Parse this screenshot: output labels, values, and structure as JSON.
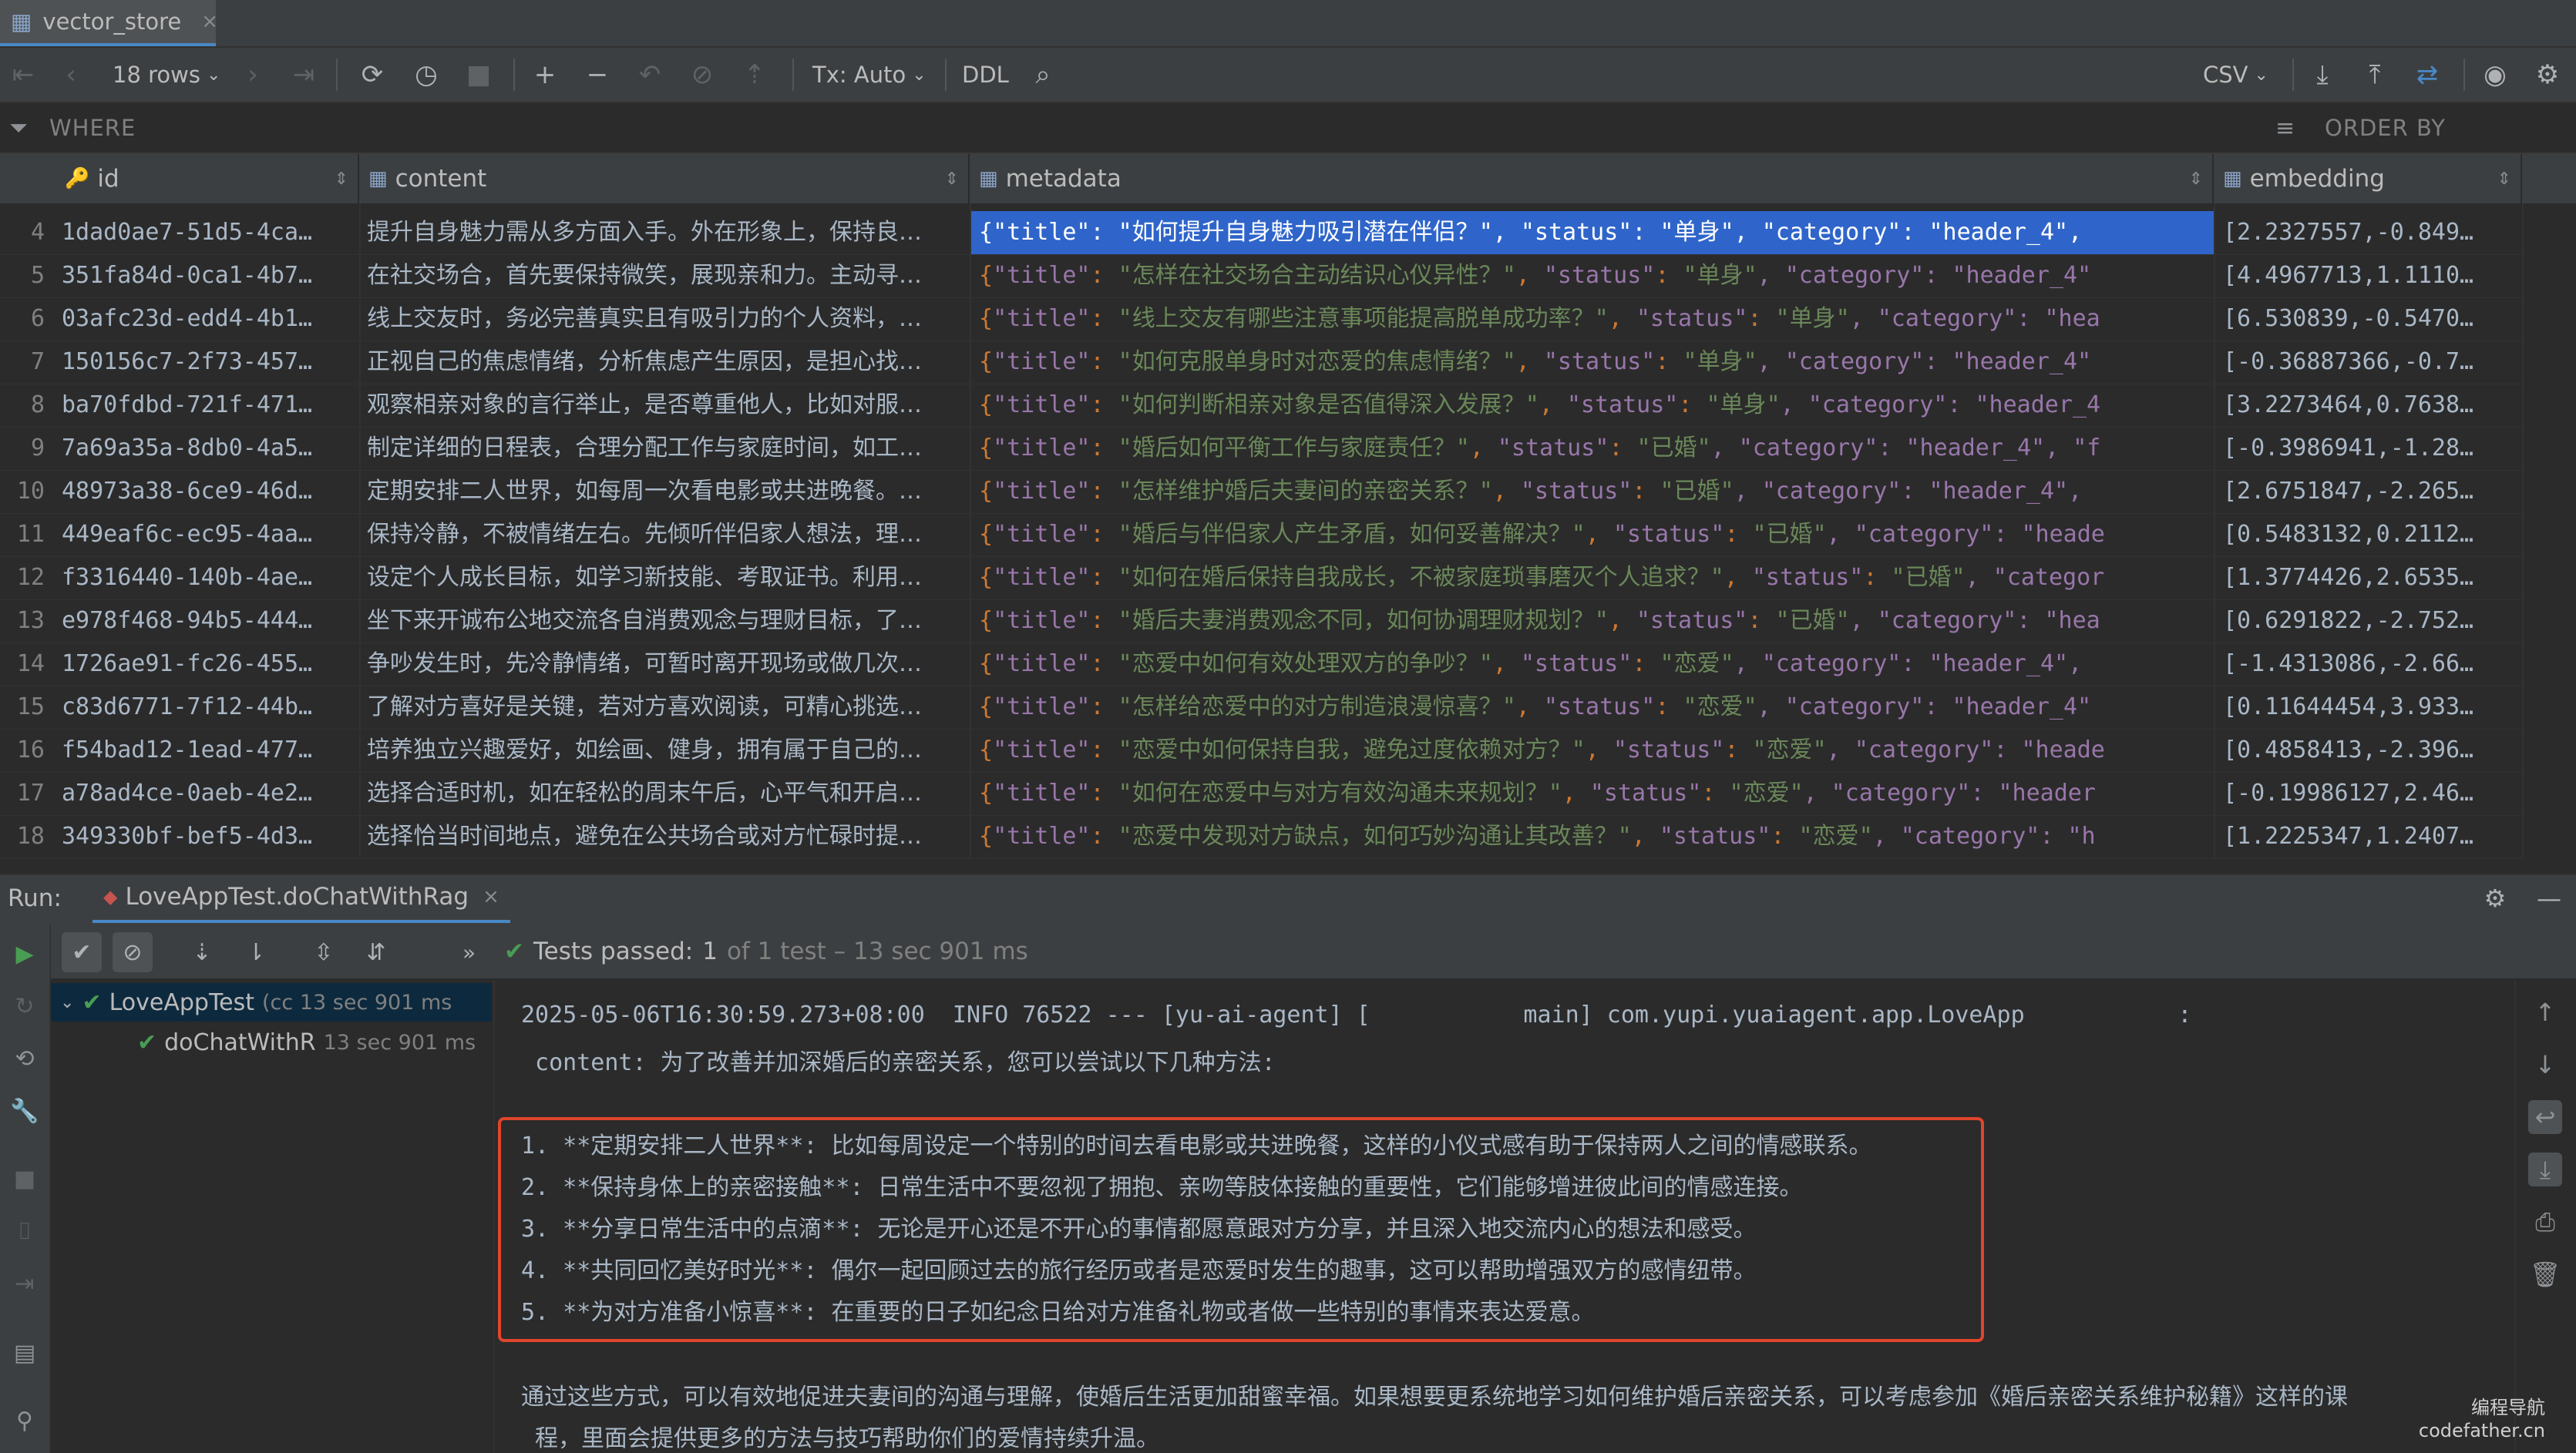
{
  "tab": {
    "title": "vector_store",
    "close": "×"
  },
  "toolbar": {
    "rows": "18 rows",
    "tx": "Tx: Auto",
    "ddl": "DDL",
    "export_format": "CSV"
  },
  "filter": {
    "where": "WHERE",
    "order_by": "ORDER BY"
  },
  "columns": [
    "id",
    "content",
    "metadata",
    "embedding"
  ],
  "rows": [
    {
      "n": "4",
      "id": "1dad0ae7-51d5-4ca…",
      "content": "提升自身魅力需从多方面入手。外在形象上，保持良…",
      "title": "如何提升自身魅力吸引潜在伴侣？",
      "status": "单身",
      "tail": ", \"category\": \"header_4\",",
      "embedding": "[2.2327557,-0.849…"
    },
    {
      "n": "5",
      "id": "351fa84d-0ca1-4b7…",
      "content": "在社交场合，首先要保持微笑，展现亲和力。主动寻…",
      "title": "怎样在社交场合主动结识心仪异性？",
      "status": "单身",
      "tail": ", \"category\": \"header_4\"",
      "embedding": "[4.4967713,1.1110…"
    },
    {
      "n": "6",
      "id": "03afc23d-edd4-4b1…",
      "content": "线上交友时，务必完善真实且有吸引力的个人资料，…",
      "title": "线上交友有哪些注意事项能提高脱单成功率？",
      "status": "单身",
      "tail": ", \"category\": \"hea",
      "embedding": "[6.530839,-0.5470…"
    },
    {
      "n": "7",
      "id": "150156c7-2f73-457…",
      "content": "正视自己的焦虑情绪，分析焦虑产生原因，是担心找…",
      "title": "如何克服单身时对恋爱的焦虑情绪？",
      "status": "单身",
      "tail": ", \"category\": \"header_4\"",
      "embedding": "[-0.36887366,-0.7…"
    },
    {
      "n": "8",
      "id": "ba70fdbd-721f-471…",
      "content": "观察相亲对象的言行举止，是否尊重他人，比如对服…",
      "title": "如何判断相亲对象是否值得深入发展？",
      "status": "单身",
      "tail": ", \"category\": \"header_4",
      "embedding": "[3.2273464,0.7638…"
    },
    {
      "n": "9",
      "id": "7a69a35a-8db0-4a5…",
      "content": "制定详细的日程表，合理分配工作与家庭时间，如工…",
      "title": "婚后如何平衡工作与家庭责任？",
      "status": "已婚",
      "tail": ", \"category\": \"header_4\", \"f",
      "embedding": "[-0.3986941,-1.28…"
    },
    {
      "n": "10",
      "id": "48973a38-6ce9-46d…",
      "content": "定期安排二人世界，如每周一次看电影或共进晚餐。…",
      "title": "怎样维护婚后夫妻间的亲密关系？",
      "status": "已婚",
      "tail": ", \"category\": \"header_4\",",
      "embedding": "[2.6751847,-2.265…"
    },
    {
      "n": "11",
      "id": "449eaf6c-ec95-4aa…",
      "content": "保持冷静，不被情绪左右。先倾听伴侣家人想法，理…",
      "title": "婚后与伴侣家人产生矛盾，如何妥善解决？",
      "status": "已婚",
      "tail": ", \"category\": \"heade",
      "embedding": "[0.5483132,0.2112…"
    },
    {
      "n": "12",
      "id": "f3316440-140b-4ae…",
      "content": "设定个人成长目标，如学习新技能、考取证书。利用…",
      "title": "如何在婚后保持自我成长，不被家庭琐事磨灭个人追求？",
      "status": "已婚",
      "tail": ", \"categor",
      "embedding": "[1.3774426,2.6535…"
    },
    {
      "n": "13",
      "id": "e978f468-94b5-444…",
      "content": "坐下来开诚布公地交流各自消费观念与理财目标，了…",
      "title": "婚后夫妻消费观念不同，如何协调理财规划？",
      "status": "已婚",
      "tail": ", \"category\": \"hea",
      "embedding": "[0.6291822,-2.752…"
    },
    {
      "n": "14",
      "id": "1726ae91-fc26-455…",
      "content": "争吵发生时，先冷静情绪，可暂时离开现场或做几次…",
      "title": "恋爱中如何有效处理双方的争吵？",
      "status": "恋爱",
      "tail": ", \"category\": \"header_4\",",
      "embedding": "[-1.4313086,-2.66…"
    },
    {
      "n": "15",
      "id": "c83d6771-7f12-44b…",
      "content": "了解对方喜好是关键，若对方喜欢阅读，可精心挑选…",
      "title": "怎样给恋爱中的对方制造浪漫惊喜？",
      "status": "恋爱",
      "tail": ", \"category\": \"header_4\"",
      "embedding": "[0.11644454,3.933…"
    },
    {
      "n": "16",
      "id": "f54bad12-1ead-477…",
      "content": "培养独立兴趣爱好，如绘画、健身，拥有属于自己的…",
      "title": "恋爱中如何保持自我，避免过度依赖对方？",
      "status": "恋爱",
      "tail": ", \"category\": \"heade",
      "embedding": "[0.4858413,-2.396…"
    },
    {
      "n": "17",
      "id": "a78ad4ce-0aeb-4e2…",
      "content": "选择合适时机，如在轻松的周末午后，心平气和开启…",
      "title": "如何在恋爱中与对方有效沟通未来规划？",
      "status": "恋爱",
      "tail": ", \"category\": \"header",
      "embedding": "[-0.19986127,2.46…"
    },
    {
      "n": "18",
      "id": "349330bf-bef5-4d3…",
      "content": "选择恰当时间地点，避免在公共场合或对方忙碌时提…",
      "title": "恋爱中发现对方缺点，如何巧妙沟通让其改善？",
      "status": "恋爱",
      "tail": ", \"category\": \"h",
      "embedding": "[1.2225347,1.2407…"
    }
  ],
  "run": {
    "label": "Run:",
    "tab": "LoveAppTest.doChatWithRag",
    "status_prefix": "Tests passed:",
    "status_count": "1",
    "status_rest": "of 1 test – 13 sec 901 ms",
    "tree": [
      {
        "name": "LoveAppTest",
        "detail": "(cc 13 sec 901 ms"
      },
      {
        "name": "doChatWithR",
        "detail": "13 sec 901 ms"
      }
    ]
  },
  "console": {
    "log_line": "2025-05-06T16:30:59.273+08:00  INFO 76522 --- [yu-ai-agent] [           main] com.yupi.yuaiagent.app.LoveApp           :",
    "content_line": " content: 为了改善并加深婚后的亲密关系，您可以尝试以下几种方法:",
    "items": [
      "1. **定期安排二人世界**: 比如每周设定一个特别的时间去看电影或共进晚餐，这样的小仪式感有助于保持两人之间的情感联系。",
      "2. **保持身体上的亲密接触**: 日常生活中不要忽视了拥抱、亲吻等肢体接触的重要性，它们能够增进彼此间的情感连接。",
      "3. **分享日常生活中的点滴**: 无论是开心还是不开心的事情都愿意跟对方分享，并且深入地交流内心的想法和感受。",
      "4. **共同回忆美好时光**: 偶尔一起回顾过去的旅行经历或者是恋爱时发生的趣事，这可以帮助增强双方的感情纽带。",
      "5. **为对方准备小惊喜**: 在重要的日子如纪念日给对方准备礼物或者做一些特别的事情来表达爱意。"
    ],
    "summary_1": "通过这些方式，可以有效地促进夫妻间的沟通与理解，使婚后生活更加甜蜜幸福。如果想要更系统地学习如何维护婚后亲密关系，可以考虑参加《婚后亲密关系维护秘籍》这样的课",
    "summary_2": " 程，里面会提供更多的方法与技巧帮助你们的爱情持续升温。"
  },
  "watermark": {
    "line1": "编程导航",
    "line2": "codefather.cn"
  },
  "colors": {
    "selection": "#2f65ca",
    "redbox": "#e0452c",
    "pass": "#499c54",
    "string": "#6a8759",
    "key": "#9876aa"
  }
}
